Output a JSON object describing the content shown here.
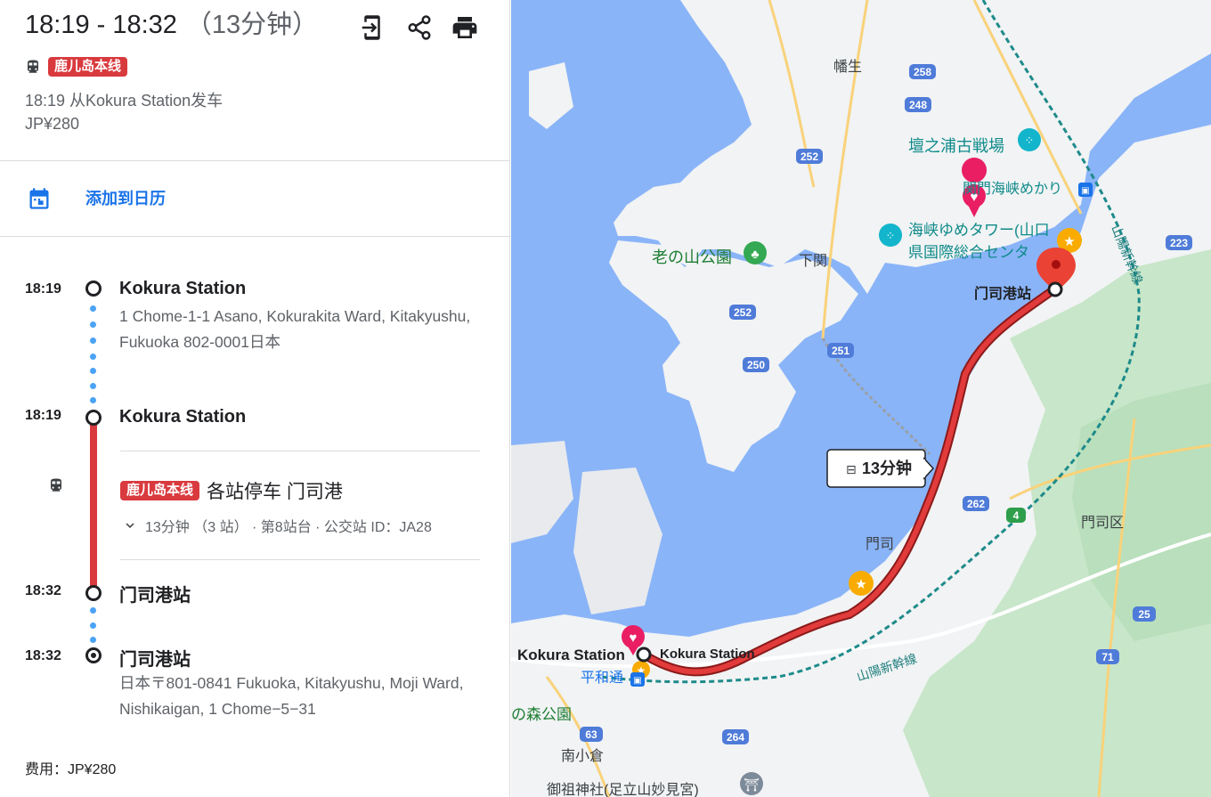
{
  "header": {
    "time_range": "18:19 - 18:32",
    "duration": "（13分钟）",
    "tools": [
      "send-to-phone-icon",
      "share-icon",
      "print-icon"
    ]
  },
  "summary": {
    "line_name": "鹿儿岛本线",
    "departure": "18:19 从Kokura Station发车",
    "price": "JP¥280"
  },
  "calendar": {
    "label": "添加到日历"
  },
  "itinerary": {
    "stops": [
      {
        "time": "18:19",
        "name": "Kokura Station",
        "address": "1 Chome-1-1 Asano, Kokurakita Ward, Kitakyushu, Fukuoka 802-0001日本"
      },
      {
        "time": "18:19",
        "name": "Kokura Station"
      },
      {
        "time": "18:32",
        "name": "门司港站"
      },
      {
        "time": "18:32",
        "name": "门司港站",
        "address": "日本〒801-0841 Fukuoka, Kitakyushu, Moji Ward, Nishikaigan, 1 Chome−5−31"
      }
    ],
    "leg": {
      "line_name": "鹿儿岛本线",
      "service": "各站停车 门司港",
      "detail": "13分钟 （3 站） · 第8站台 · 公交站 ID：JA28"
    }
  },
  "fare": "费用：JP¥280",
  "map": {
    "duration_label": "13分钟",
    "route_color": "#c5221f",
    "water_color": "#8ab4f8",
    "land_color": "#f1f3f4",
    "places": {
      "yahata": "幡生",
      "dannoura": "壇之浦古戦場",
      "kaikyo": "関門海峡めかり",
      "tower1": "海峡ゆめタワー(山口",
      "tower2": "県国際総合センタ",
      "park": "老の山公園",
      "shimonoseki": "下関",
      "mojikou": "门司港站",
      "moji": "門司",
      "mojiku": "門司区",
      "kokura_left": "Kokura Station",
      "kokura_right": "Kokura Station",
      "heiwadori": "平和通",
      "mori_park": "の森公園",
      "minami": "南小倉",
      "shrine": "御祖神社(足立山妙見宮)",
      "sanyo1": "山陽新幹線",
      "sanyo2": "山陽新幹線"
    },
    "roads": [
      "258",
      "248",
      "252",
      "223",
      "252",
      "251",
      "250",
      "262",
      "4",
      "25",
      "71",
      "63",
      "264"
    ]
  }
}
